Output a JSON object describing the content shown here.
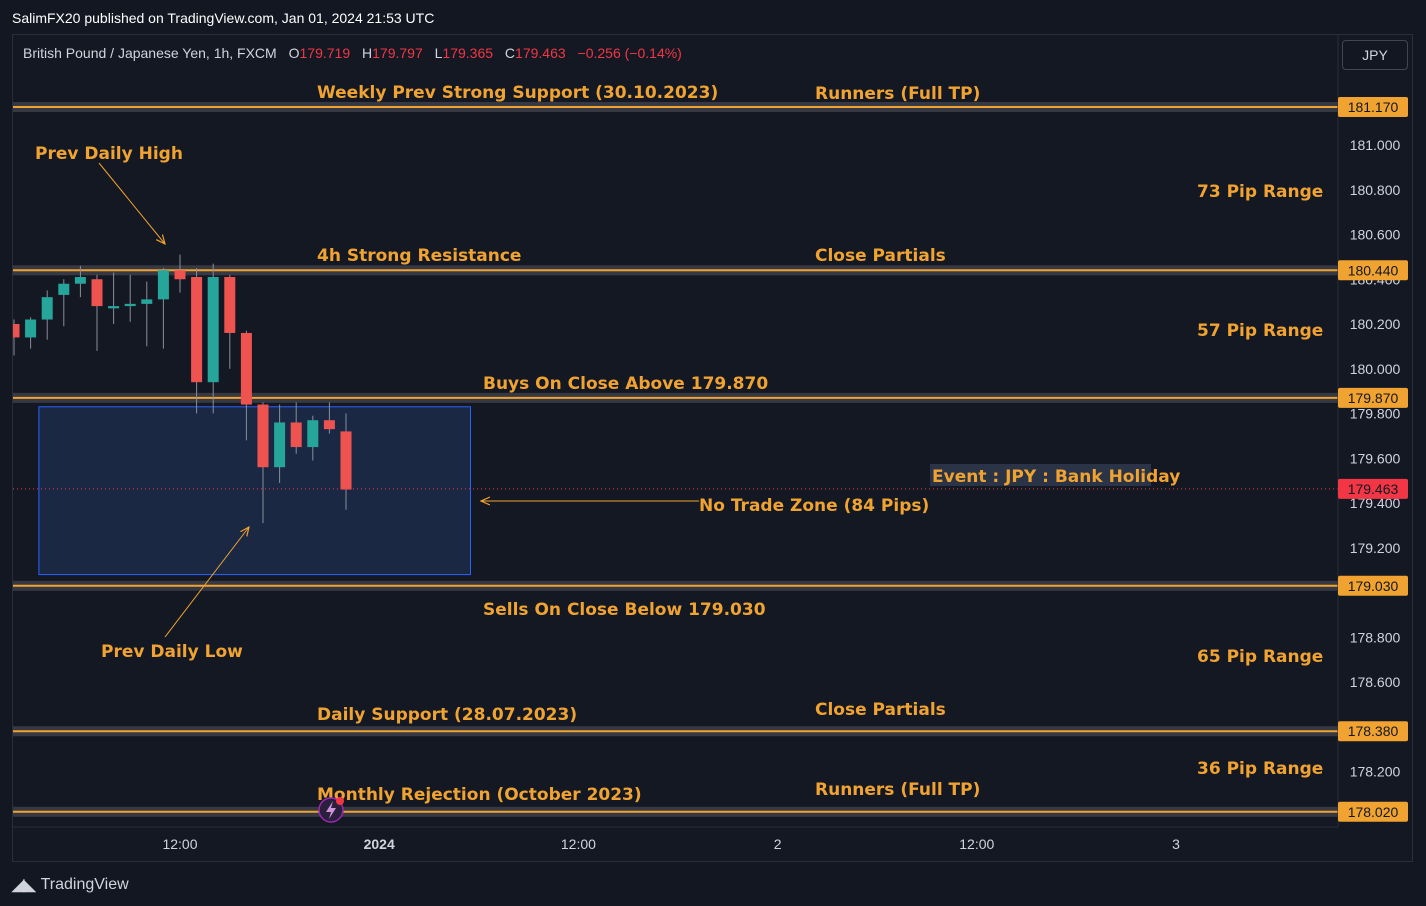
{
  "publisher": "SalimFX20 published on TradingView.com, Jan 01, 2024 21:53 UTC",
  "header": {
    "symbol": "British Pound / Japanese Yen, 1h, FXCM",
    "o_label": "O",
    "o": "179.719",
    "h_label": "H",
    "h": "179.797",
    "l_label": "L",
    "l": "179.365",
    "c_label": "C",
    "c": "179.463",
    "change": "−0.256 (−0.14%)"
  },
  "currency_button": "JPY",
  "footer_brand": "TradingView",
  "colors": {
    "background": "#131722",
    "up_candle": "#26a69a",
    "down_candle": "#ef5350",
    "level_line": "#f0a330",
    "zone_fill": "#1c2b4a",
    "zone_border": "#2962ff",
    "last_price": "#f23645"
  },
  "chart_data": {
    "type": "candlestick",
    "ylim": [
      177.9,
      181.35
    ],
    "y_ticks": [
      "181.000",
      "180.800",
      "180.600",
      "180.400",
      "180.200",
      "180.000",
      "179.800",
      "179.600",
      "179.400",
      "179.200",
      "178.800",
      "178.600",
      "178.200"
    ],
    "x_ticks": [
      {
        "label": "12:00",
        "bar": 10,
        "bold": false
      },
      {
        "label": "2024",
        "bar": 22,
        "bold": true
      },
      {
        "label": "12:00",
        "bar": 34,
        "bold": false
      },
      {
        "label": "2",
        "bar": 46,
        "bold": false
      },
      {
        "label": "12:00",
        "bar": 58,
        "bold": false
      },
      {
        "label": "3",
        "bar": 70,
        "bold": false
      }
    ],
    "candles": [
      {
        "o": 180.2,
        "h": 180.22,
        "l": 180.06,
        "c": 180.14
      },
      {
        "o": 180.14,
        "h": 180.23,
        "l": 180.09,
        "c": 180.22
      },
      {
        "o": 180.22,
        "h": 180.35,
        "l": 180.13,
        "c": 180.32
      },
      {
        "o": 180.33,
        "h": 180.4,
        "l": 180.19,
        "c": 180.38
      },
      {
        "o": 180.38,
        "h": 180.46,
        "l": 180.32,
        "c": 180.41
      },
      {
        "o": 180.4,
        "h": 180.42,
        "l": 180.08,
        "c": 180.28
      },
      {
        "o": 180.27,
        "h": 180.43,
        "l": 180.2,
        "c": 180.28
      },
      {
        "o": 180.28,
        "h": 180.42,
        "l": 180.21,
        "c": 180.29
      },
      {
        "o": 180.29,
        "h": 180.39,
        "l": 180.1,
        "c": 180.31
      },
      {
        "o": 180.31,
        "h": 180.45,
        "l": 180.09,
        "c": 180.44
      },
      {
        "o": 180.44,
        "h": 180.51,
        "l": 180.34,
        "c": 180.4
      },
      {
        "o": 180.41,
        "h": 180.45,
        "l": 179.8,
        "c": 179.94
      },
      {
        "o": 179.94,
        "h": 180.47,
        "l": 179.8,
        "c": 180.41
      },
      {
        "o": 180.41,
        "h": 180.42,
        "l": 180.0,
        "c": 180.16
      },
      {
        "o": 180.16,
        "h": 180.17,
        "l": 179.68,
        "c": 179.84
      },
      {
        "o": 179.84,
        "h": 179.85,
        "l": 179.31,
        "c": 179.56
      },
      {
        "o": 179.56,
        "h": 179.84,
        "l": 179.49,
        "c": 179.76
      },
      {
        "o": 179.76,
        "h": 179.85,
        "l": 179.62,
        "c": 179.65
      },
      {
        "o": 179.65,
        "h": 179.79,
        "l": 179.59,
        "c": 179.77
      },
      {
        "o": 179.77,
        "h": 179.85,
        "l": 179.71,
        "c": 179.73
      },
      {
        "o": 179.72,
        "h": 179.8,
        "l": 179.37,
        "c": 179.46
      }
    ],
    "levels": [
      {
        "price": 181.17,
        "label": "181.170"
      },
      {
        "price": 180.44,
        "label": "180.440"
      },
      {
        "price": 179.87,
        "label": "179.870"
      },
      {
        "price": 179.03,
        "label": "179.030"
      },
      {
        "price": 178.38,
        "label": "178.380"
      },
      {
        "price": 178.02,
        "label": "178.020"
      }
    ],
    "last_price": {
      "price": 179.463,
      "label": "179.463"
    },
    "no_trade_zone": {
      "top": 179.83,
      "bottom": 179.08,
      "start_bar": 1.5,
      "end_bar": 27.5
    },
    "annotations": {
      "weekly_support": "Weekly Prev Strong Support (30.10.2023)",
      "runners_top": "Runners (Full TP)",
      "prev_daily_high": "Prev Daily High",
      "pip_73": "73 Pip Range",
      "resistance_4h": "4h Strong Resistance",
      "close_partials_top": "Close Partials",
      "pip_57": "57 Pip Range",
      "buys_above": "Buys On Close Above 179.870",
      "event": "Event : JPY : Bank Holiday",
      "no_trade_zone": "No Trade Zone (84 Pips)",
      "sells_below": "Sells On Close Below 179.030",
      "prev_daily_low": "Prev Daily Low",
      "pip_65": "65 Pip Range",
      "daily_support": "Daily Support (28.07.2023)",
      "close_partials_bottom": "Close Partials",
      "pip_36": "36 Pip Range",
      "monthly_rejection": "Monthly Rejection (October 2023)",
      "runners_bottom": "Runners (Full TP)"
    }
  }
}
